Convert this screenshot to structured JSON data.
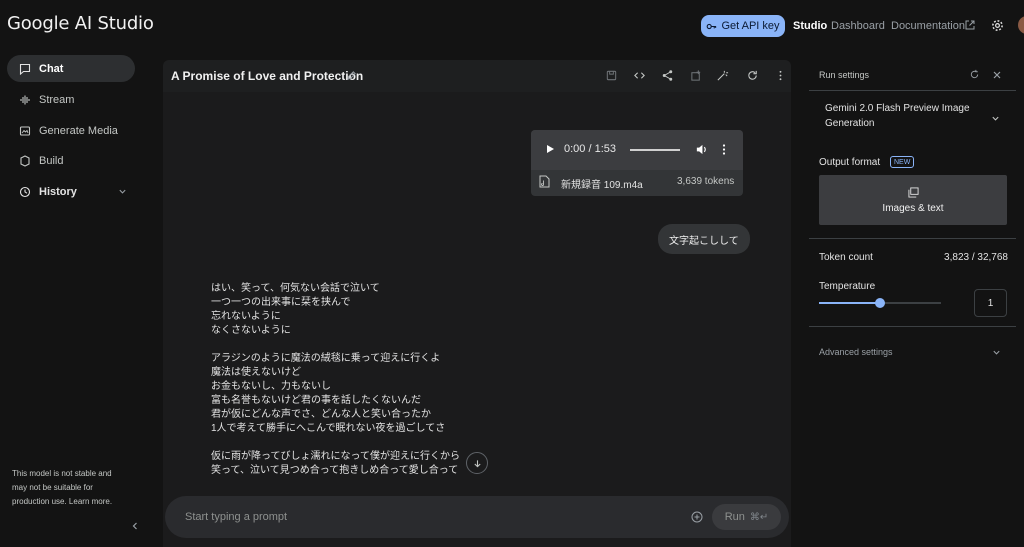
{
  "header": {
    "brand": "Google AI Studio",
    "api_key_label": "Get API key",
    "nav": {
      "studio": "Studio",
      "dashboard": "Dashboard",
      "documentation": "Documentation"
    }
  },
  "sidebar": {
    "items": [
      {
        "label": "Chat",
        "icon": "chat-icon",
        "active": true
      },
      {
        "label": "Stream",
        "icon": "stream-icon"
      },
      {
        "label": "Generate Media",
        "icon": "media-icon"
      },
      {
        "label": "Build",
        "icon": "build-icon"
      },
      {
        "label": "History",
        "icon": "history-icon"
      }
    ],
    "note": "This model is not stable and may not be suitable for production use. Learn more."
  },
  "chat": {
    "title": "A Promise of Love and Protection",
    "audio": {
      "time": "0:00 / 1:53",
      "file_name": "新規録音 109.m4a",
      "tokens": "3,639 tokens"
    },
    "user_message": "文字起こしして",
    "response_paragraphs": [
      [
        "はい、笑って、何気ない会話で泣いて",
        "一つ一つの出来事に栞を挟んで",
        "忘れないように",
        "なくさないように"
      ],
      [
        "アラジンのように魔法の絨毯に乗って迎えに行くよ",
        "魔法は使えないけど",
        "お金もないし、力もないし",
        "富も名誉もないけど君の事を話したくないんだ",
        "君が仮にどんな声でさ、どんな人と笑い合ったか",
        "1人で考えて勝手にへこんで眠れない夜を過ごしてさ"
      ],
      [
        "仮に雨が降ってびしょ濡れになって僕が迎えに行くから",
        "笑って、泣いて見つめ合って抱きしめ合って愛し合って"
      ]
    ],
    "prompt_placeholder": "Start typing a prompt",
    "run_label": "Run",
    "run_shortcut": "⌘↵"
  },
  "settings": {
    "title": "Run settings",
    "model": "Gemini 2.0 Flash Preview Image Generation",
    "output_format_label": "Output format",
    "new_badge": "NEW",
    "output_format_value": "Images & text",
    "token_count_label": "Token count",
    "token_count_value": "3,823 / 32,768",
    "temperature_label": "Temperature",
    "temperature_value": "1",
    "temperature_fraction": 0.5,
    "advanced_label": "Advanced settings"
  },
  "colors": {
    "accent": "#8ab4f8",
    "background": "#131313",
    "panel": "#1b1b1c"
  }
}
